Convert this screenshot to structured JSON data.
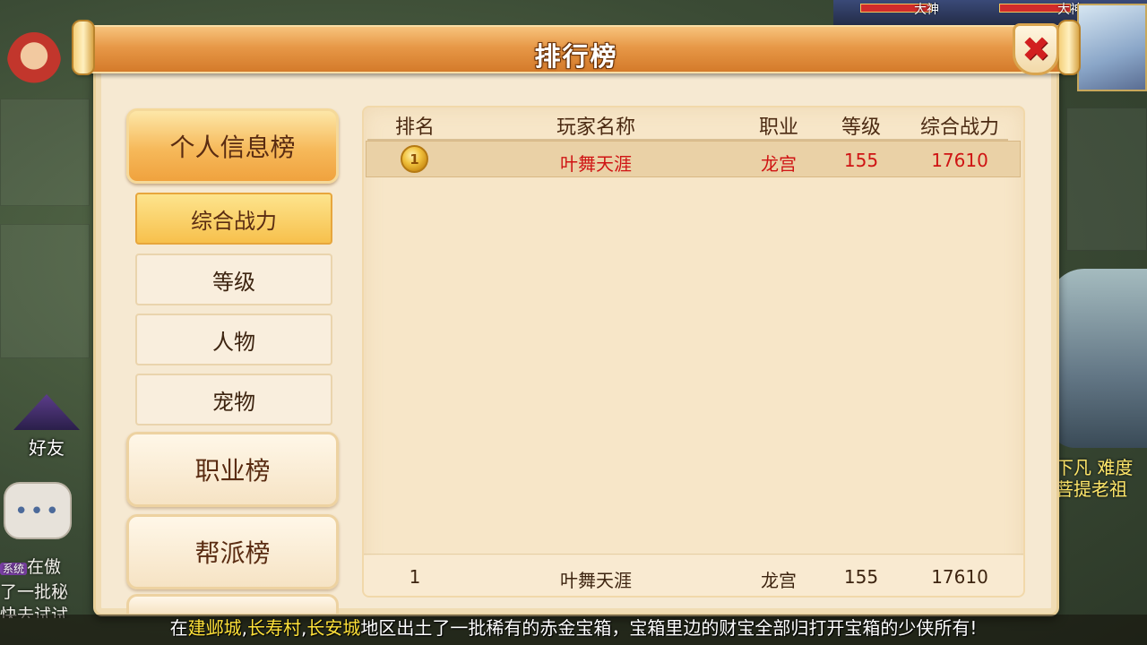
{
  "dialog": {
    "title": "排行榜",
    "close_icon": "close-icon"
  },
  "nav": {
    "categories": [
      {
        "label": "个人信息榜",
        "active": true
      },
      {
        "label": "职业榜",
        "active": false
      },
      {
        "label": "帮派榜",
        "active": false
      }
    ],
    "subtabs": [
      {
        "label": "综合战力",
        "active": true
      },
      {
        "label": "等级",
        "active": false
      },
      {
        "label": "人物",
        "active": false
      },
      {
        "label": "宠物",
        "active": false
      }
    ]
  },
  "table": {
    "columns": [
      "排名",
      "玩家名称",
      "职业",
      "等级",
      "综合战力"
    ],
    "rows": [
      {
        "rank_icon": "gold-medal-icon",
        "name": "叶舞天涯",
        "job": "龙宫",
        "level": "155",
        "power": "17610"
      }
    ],
    "my_row": {
      "rank": "1",
      "name": "叶舞天涯",
      "job": "龙宫",
      "level": "155",
      "power": "17610"
    }
  },
  "announcement": {
    "prefix": "在",
    "loc1": "建邺城",
    "sep1": ",",
    "loc2": "长寿村",
    "sep2": ",",
    "loc3": "长安城",
    "rest": "地区出土了一批稀有的赤金宝箱，宝箱里边的财宝全部归打开宝箱的少侠所有!"
  },
  "background": {
    "friend_label": "好友",
    "hud_labels": [
      "大神",
      "大神"
    ],
    "chat_sys_badge": "系统",
    "chat_lines": [
      "在傲",
      "了一批秘",
      "快去试试"
    ],
    "right_text": [
      "下凡 难度",
      "菩提老祖"
    ]
  },
  "colors": {
    "accent_orange": "#e79847",
    "highlight_red": "#cf1414",
    "location_yellow": "#ffe23a"
  }
}
